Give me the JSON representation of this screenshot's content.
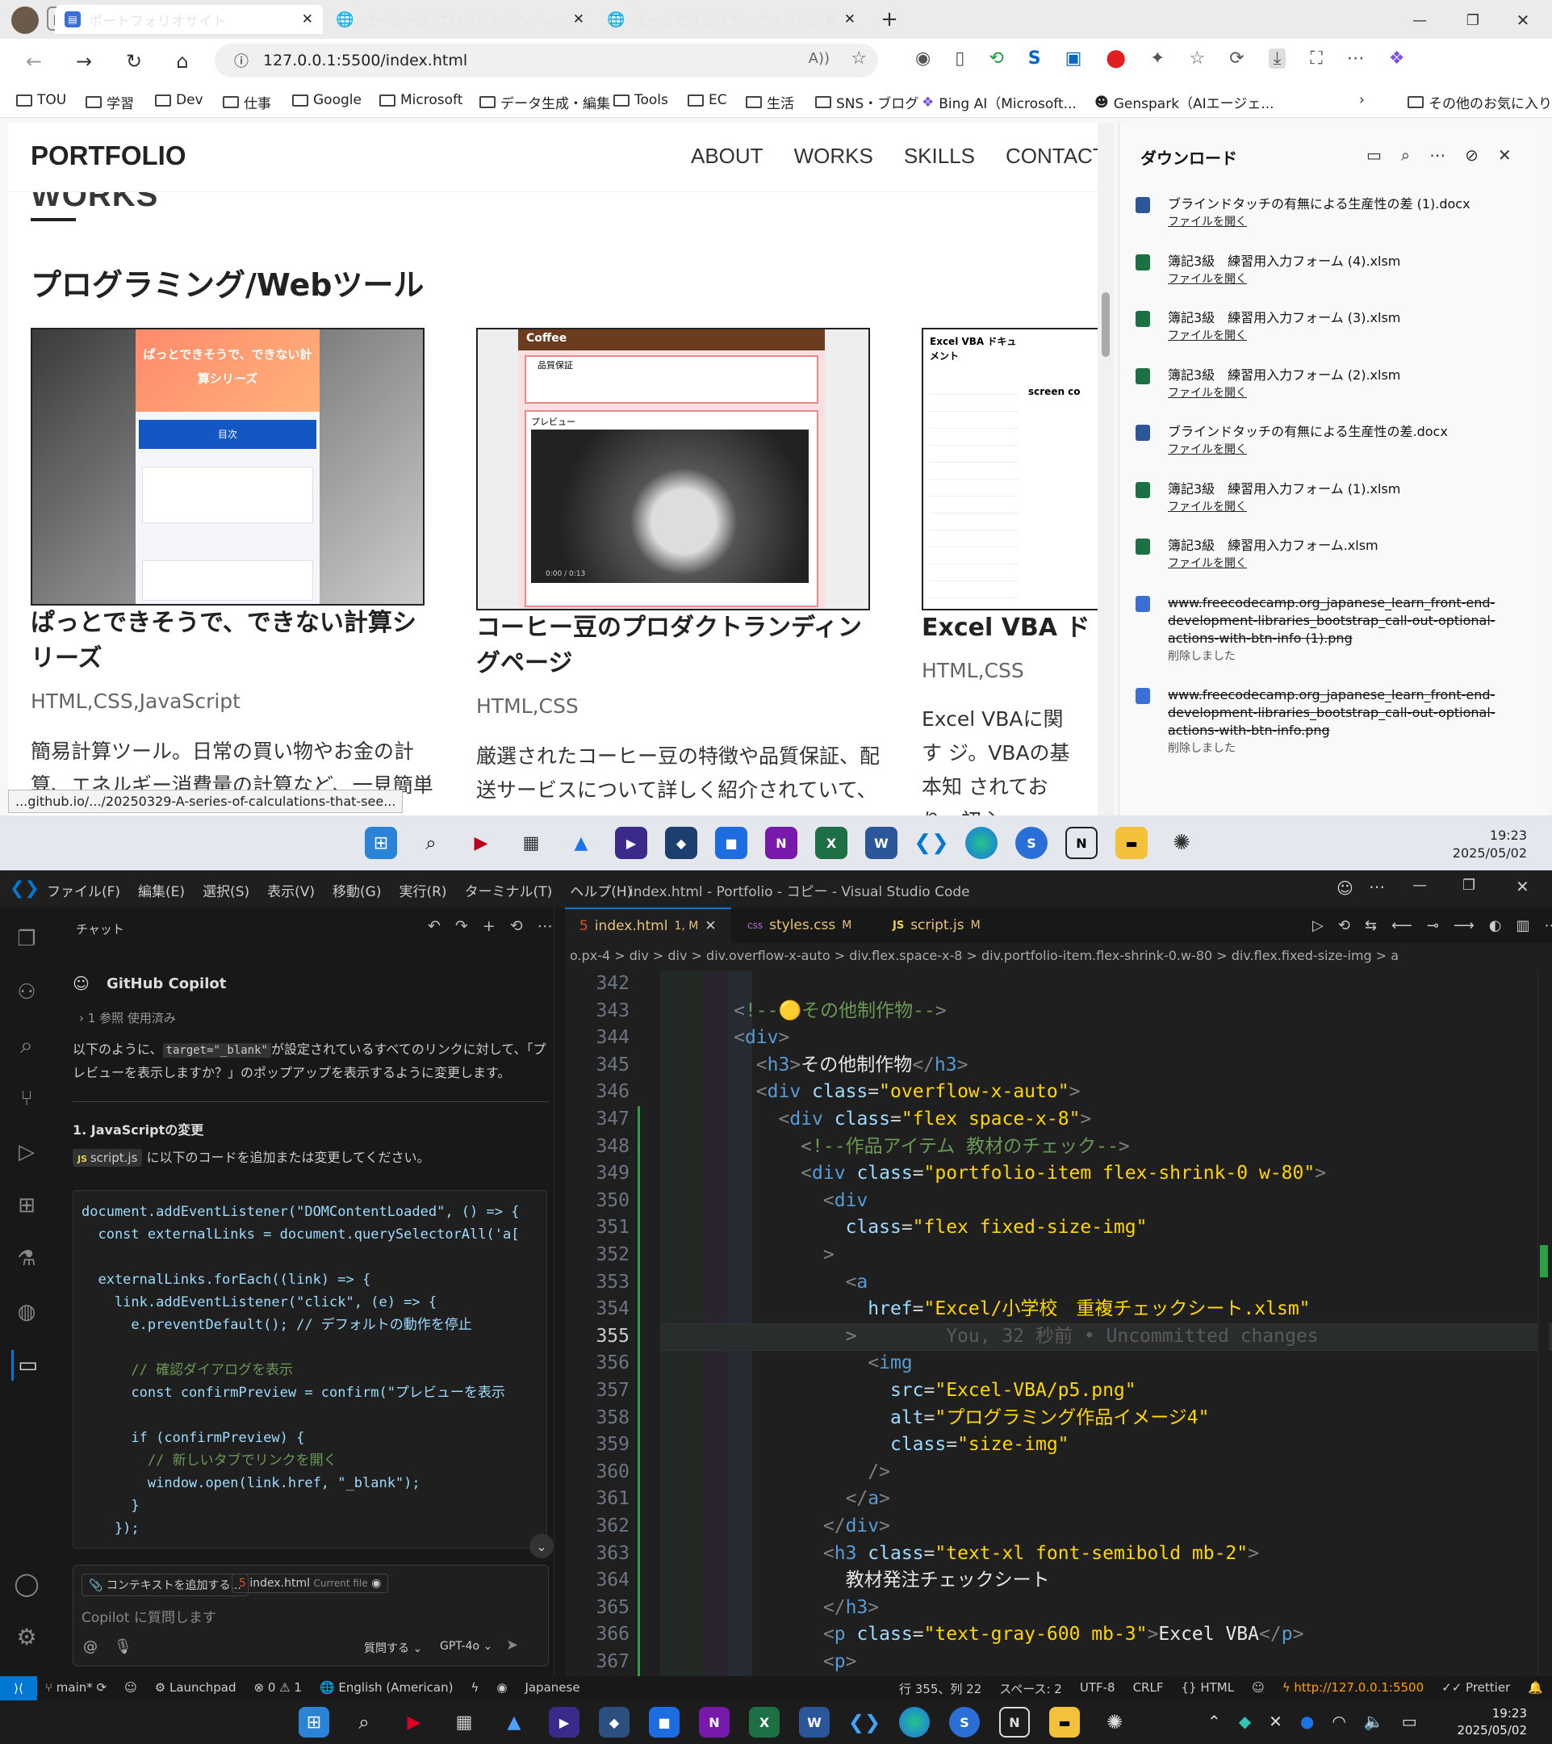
{
  "browser": {
    "tabs": [
      {
        "title": "ポートフォリオサイト",
        "active": true
      },
      {
        "title": "コーヒー豆 プロダクトランディングページ",
        "active": false
      },
      {
        "title": "ぱっとできそうで、できない計算シリーズ",
        "active": false
      }
    ],
    "url": "127.0.0.1:5500/index.html",
    "bookmarks": [
      "TOU",
      "学習",
      "Dev",
      "仕事",
      "Google",
      "Microsoft",
      "データ生成・編集",
      "Tools",
      "EC",
      "生活",
      "SNS・ブログ",
      "Bing AI（Microsoft...",
      "Genspark（AIエージェ...",
      "その他のお気に入り"
    ],
    "status_link": "...github.io/.../20250329-A-series-of-calculations-that-see..."
  },
  "page": {
    "logo": "PORTFOLIO",
    "nav": [
      "ABOUT",
      "WORKS",
      "SKILLS",
      "CONTACT"
    ],
    "section_ghost": "WORKS",
    "section_title": "プログラミング/Webツール",
    "cards": [
      {
        "title": "ぱっとできそうで、できない計算シリーズ",
        "tech": "HTML,CSS,JavaScript",
        "desc": "簡易計算ツール。日常の買い物やお金の計算、エネルギー消費量の計算など、一見簡単",
        "thumb_title": "ぱっとできそうで、できない計算シリーズ",
        "thumb_sub": "目次"
      },
      {
        "title": "コーヒー豆のプロダクトランディングページ",
        "tech": "HTML,CSS",
        "desc": "厳選されたコーヒー豆の特徴や品質保証、配送サービスについて詳しく紹介されていて、",
        "thumb_brand": "Coffee",
        "thumb_label": "品質保証",
        "thumb_preview": "プレビュー",
        "thumb_time": "0:00 / 0:13"
      },
      {
        "title": "Excel VBA ド",
        "tech": "HTML,CSS",
        "desc": "Excel VBAに関す ジ。VBAの基本知 されており、初心",
        "thumb_title": "Excel VBA ドキュメント",
        "thumb_head": "screen co"
      }
    ]
  },
  "downloads": {
    "title": "ダウンロード",
    "items": [
      {
        "name": "ブラインドタッチの有無による生産性の差 (1).docx",
        "action": "ファイルを開く",
        "type": "word",
        "deleted": false
      },
      {
        "name": "簿記3級　練習用入力フォーム (4).xlsm",
        "action": "ファイルを開く",
        "type": "excel",
        "deleted": false
      },
      {
        "name": "簿記3級　練習用入力フォーム (3).xlsm",
        "action": "ファイルを開く",
        "type": "excel",
        "deleted": false
      },
      {
        "name": "簿記3級　練習用入力フォーム (2).xlsm",
        "action": "ファイルを開く",
        "type": "excel",
        "deleted": false
      },
      {
        "name": "ブラインドタッチの有無による生産性の差.docx",
        "action": "ファイルを開く",
        "type": "word",
        "deleted": false
      },
      {
        "name": "簿記3級　練習用入力フォーム (1).xlsm",
        "action": "ファイルを開く",
        "type": "excel",
        "deleted": false
      },
      {
        "name": "簿記3級　練習用入力フォーム.xlsm",
        "action": "ファイルを開く",
        "type": "excel",
        "deleted": false
      },
      {
        "name": "www.freecodecamp.org_japanese_learn_front-end-development-libraries_bootstrap_call-out-optional-actions-with-btn-info (1).png",
        "action": "削除しました",
        "type": "png",
        "deleted": true
      },
      {
        "name": "www.freecodecamp.org_japanese_learn_front-end-development-libraries_bootstrap_call-out-optional-actions-with-btn-info.png",
        "action": "削除しました",
        "type": "png",
        "deleted": true
      }
    ]
  },
  "clock": {
    "time": "19:23",
    "date": "2025/05/02"
  },
  "vscode": {
    "menu": [
      "ファイル(F)",
      "編集(E)",
      "選択(S)",
      "表示(V)",
      "移動(G)",
      "実行(R)",
      "ターミナル(T)",
      "ヘルプ(H)"
    ],
    "title": "index.html - Portfolio - コピー - Visual Studio Code",
    "chat": {
      "header": "チャット",
      "agent": "GitHub Copilot",
      "refs": "1 参照 使用済み",
      "intro_1": "以下のように、",
      "intro_code": "target=\"_blank\"",
      "intro_2": "が設定されているすべてのリンクに対して、「プレビューを表示しますか？」のポップアップを表示するように変更します。",
      "step": "1. JavaScriptの変更",
      "step_file": "script.js",
      "step_text": "に以下のコードを追加または変更してください。",
      "code": [
        "document.addEventListener(\"DOMContentLoaded\", () => {",
        "  const externalLinks = document.querySelectorAll('a[",
        "",
        "  externalLinks.forEach((link) => {",
        "    link.addEventListener(\"click\", (e) => {",
        "      e.preventDefault(); // デフォルトの動作を停止",
        "",
        "      // 確認ダイアログを表示",
        "      const confirmPreview = confirm(\"プレビューを表示",
        "",
        "      if (confirmPreview) {",
        "        // 新しいタブでリンクを開く",
        "        window.open(link.href, \"_blank\");",
        "      }",
        "    });"
      ],
      "context_btn": "コンテキストを追加する...",
      "current_file": "index.html",
      "current_file_tag": "Current file",
      "placeholder": "Copilot に質問します",
      "mode": "質問する",
      "model": "GPT-4o"
    },
    "tabs": [
      {
        "name": "index.html",
        "badge": "1, M",
        "active": true
      },
      {
        "name": "styles.css",
        "badge": "M",
        "active": false
      },
      {
        "name": "script.js",
        "badge": "M",
        "active": false
      }
    ],
    "breadcrumb": "o.px-4 > div > div > div.overflow-x-auto > div.flex.space-x-8 > div.portfolio-item.flex-shrink-0.w-80 > div.flex.fixed-size-img > a",
    "lines": [
      {
        "n": "342",
        "html": ""
      },
      {
        "n": "343",
        "html": "<span class=\"tb\">&lt;</span><span class=\"cm\">!--🟡その他制作物--</span><span class=\"tb\">&gt;</span>"
      },
      {
        "n": "344",
        "html": "<span class=\"tb\">&lt;</span><span class=\"t\">div</span><span class=\"tb\">&gt;</span>"
      },
      {
        "n": "345",
        "html": "  <span class=\"tb\">&lt;</span><span class=\"t\">h3</span><span class=\"tb\">&gt;</span><span class=\"tx\">その他制作物</span><span class=\"tb\">&lt;/</span><span class=\"t\">h3</span><span class=\"tb\">&gt;</span>"
      },
      {
        "n": "346",
        "html": "  <span class=\"tb\">&lt;</span><span class=\"t\">div</span> <span class=\"at\">class</span>=<span class=\"sv\">\"overflow-x-auto\"</span><span class=\"tb\">&gt;</span>"
      },
      {
        "n": "347",
        "html": "    <span class=\"tb\">&lt;</span><span class=\"t\">div</span> <span class=\"at\">class</span>=<span class=\"sv\">\"flex space-x-8\"</span><span class=\"tb\">&gt;</span>"
      },
      {
        "n": "348",
        "html": "      <span class=\"tb\">&lt;</span><span class=\"cm\">!--作品アイテム 教材のチェック--</span><span class=\"tb\">&gt;</span>"
      },
      {
        "n": "349",
        "html": "      <span class=\"tb\">&lt;</span><span class=\"t\">div</span> <span class=\"at\">class</span>=<span class=\"sv\">\"portfolio-item flex-shrink-0 w-80\"</span><span class=\"tb\">&gt;</span>"
      },
      {
        "n": "350",
        "html": "        <span class=\"tb\">&lt;</span><span class=\"t\">div</span>"
      },
      {
        "n": "351",
        "html": "          <span class=\"at\">class</span>=<span class=\"sv\">\"flex fixed-size-img\"</span>"
      },
      {
        "n": "352",
        "html": "        <span class=\"tb\">&gt;</span>"
      },
      {
        "n": "353",
        "html": "          <span class=\"tb\">&lt;</span><span class=\"t\">a</span>"
      },
      {
        "n": "354",
        "html": "            <span class=\"at\">href</span>=<span class=\"sv\">\"Excel/小学校　重複チェックシート.xlsm\"</span>"
      },
      {
        "n": "355",
        "html": "          <span class=\"tb\">&gt;</span>        <span style=\"color:#5a5a5a\">You, 32 秒前 • Uncommitted changes</span>"
      },
      {
        "n": "356",
        "html": "            <span class=\"tb\">&lt;</span><span class=\"t\">img</span>"
      },
      {
        "n": "357",
        "html": "              <span class=\"at\">src</span>=<span class=\"sv\">\"Excel-VBA/p5.png\"</span>"
      },
      {
        "n": "358",
        "html": "              <span class=\"at\">alt</span>=<span class=\"sv\">\"プログラミング作品イメージ4\"</span>"
      },
      {
        "n": "359",
        "html": "              <span class=\"at\">class</span>=<span class=\"sv\">\"size-img\"</span>"
      },
      {
        "n": "360",
        "html": "            <span class=\"tb\">/&gt;</span>"
      },
      {
        "n": "361",
        "html": "          <span class=\"tb\">&lt;/</span><span class=\"t\">a</span><span class=\"tb\">&gt;</span>"
      },
      {
        "n": "362",
        "html": "        <span class=\"tb\">&lt;/</span><span class=\"t\">div</span><span class=\"tb\">&gt;</span>"
      },
      {
        "n": "363",
        "html": "        <span class=\"tb\">&lt;</span><span class=\"t\">h3</span> <span class=\"at\">class</span>=<span class=\"sv\">\"text-xl font-semibold mb-2\"</span><span class=\"tb\">&gt;</span>"
      },
      {
        "n": "364",
        "html": "          <span class=\"tx\">教材発注チェックシート</span>"
      },
      {
        "n": "365",
        "html": "        <span class=\"tb\">&lt;/</span><span class=\"t\">h3</span><span class=\"tb\">&gt;</span>"
      },
      {
        "n": "366",
        "html": "        <span class=\"tb\">&lt;</span><span class=\"t\">p</span> <span class=\"at\">class</span>=<span class=\"sv\">\"text-gray-600 mb-3\"</span><span class=\"tb\">&gt;</span><span class=\"tx\">Excel VBA</span><span class=\"tb\">&lt;/</span><span class=\"t\">p</span><span class=\"tb\">&gt;</span>"
      },
      {
        "n": "367",
        "html": "        <span class=\"tb\">&lt;</span><span class=\"t\">p</span><span class=\"tb\">&gt;</span>"
      }
    ],
    "current_line": "355",
    "status": {
      "branch": "main*",
      "launchpad": "Launchpad",
      "problems": "⊗ 0 ⚠ 1",
      "locale": "English (American)",
      "lang": "Japanese",
      "position": "行 355、列 22",
      "spaces": "スペース: 2",
      "encoding": "UTF-8",
      "eol": "CRLF",
      "mode": "HTML",
      "server": "http://127.0.0.1:5500",
      "formatter": "Prettier"
    }
  },
  "colors": {
    "accent": "#0078d4",
    "coffee": "#6b3d1e",
    "excel": "#1d7044",
    "word": "#2b579a"
  }
}
